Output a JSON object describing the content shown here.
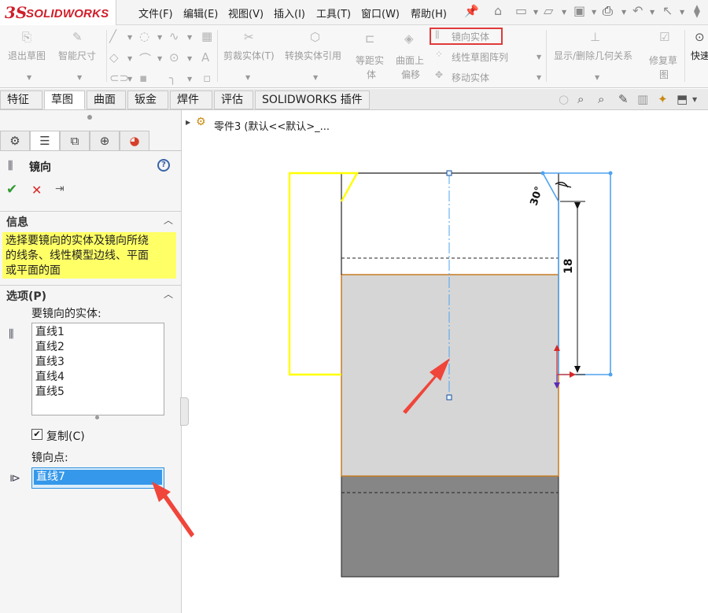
{
  "app": {
    "logo_mark": "3S",
    "logo_text": "SOLIDWORKS"
  },
  "menu": {
    "items": [
      "文件(F)",
      "编辑(E)",
      "视图(V)",
      "插入(I)",
      "工具(T)",
      "窗口(W)",
      "帮助(H)"
    ]
  },
  "ribbon": {
    "exit_sketch": "退出草图",
    "smart_dimension": "智能尺寸",
    "trim_entities": "剪裁实体(T)",
    "convert_entities": "转换实体引用",
    "offset_line1": "等距实",
    "offset_line2": "体",
    "surface_offset_line1": "曲面上",
    "surface_offset_line2": "偏移",
    "mirror_entities": "镜向实体",
    "linear_pattern": "线性草图阵列",
    "move_entities": "移动实体",
    "display_relations": "显示/删除几何关系",
    "repair_sketch_line1": "修复草",
    "repair_sketch_line2": "图",
    "quick_snaps": "快速"
  },
  "tabs": [
    "特征",
    "草图",
    "曲面",
    "钣金",
    "焊件",
    "评估",
    "SOLIDWORKS 插件"
  ],
  "active_tab": "草图",
  "property_manager": {
    "title": "镜向",
    "help_glyph": "?",
    "info_header": "信息",
    "info_line1": "选择要镜向的实体及镜向所绕",
    "info_line2": "的线条、线性模型边线、平面",
    "info_line3": "或平面的面",
    "options_header": "选项(P)",
    "entities_label": "要镜向的实体:",
    "entities": [
      "直线1",
      "直线2",
      "直线3",
      "直线4",
      "直线5"
    ],
    "copy_label": "复制(C)",
    "copy_checked": true,
    "mirror_point_label": "镜向点:",
    "mirror_point_value": "直线7"
  },
  "feature_tree": {
    "part_label": "零件3  (默认<<默认>_..."
  },
  "sketch": {
    "angle_dimension": "30°",
    "length_dimension": "18"
  },
  "colors": {
    "highlight_red": "#e03a3a",
    "info_yellow": "#ffff66",
    "selection_blue": "#3598ea",
    "sketch_yellow": "#ffff00",
    "sketch_selected_blue": "#4fa3f0",
    "part_edge_orange": "#c77a22",
    "part_face_light": "#d6d6d6",
    "part_face_dark": "#868686"
  },
  "icons": {
    "menu_pin": "pin-icon",
    "ok": "check-icon",
    "cancel": "close-icon",
    "mirror": "mirror-icon"
  }
}
